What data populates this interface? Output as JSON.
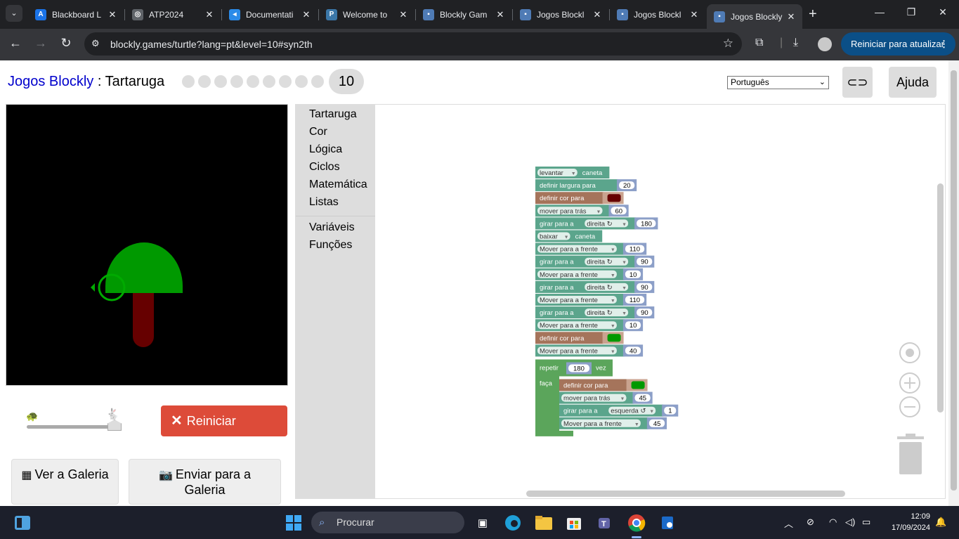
{
  "browser": {
    "tabs": [
      {
        "title": "Blackboard L",
        "favicon_color": "#1a73e8",
        "favicon_glyph": "A"
      },
      {
        "title": "ATP2024",
        "favicon_color": "#5f6368",
        "favicon_glyph": "◎"
      },
      {
        "title": "Documentati",
        "favicon_color": "#2b8be8",
        "favicon_glyph": "◂"
      },
      {
        "title": "Welcome to",
        "favicon_color": "#3b77a8",
        "favicon_glyph": "P"
      },
      {
        "title": "Blockly Gam",
        "favicon_color": "#4f7bb5",
        "favicon_glyph": "▪"
      },
      {
        "title": "Jogos Blockl",
        "favicon_color": "#4f7bb5",
        "favicon_glyph": "▪"
      },
      {
        "title": "Jogos Blockl",
        "favicon_color": "#4f7bb5",
        "favicon_glyph": "▪"
      },
      {
        "title": "Jogos Blockly",
        "favicon_color": "#4f7bb5",
        "favicon_glyph": "▪",
        "active": true
      }
    ],
    "url": "blockly.games/turtle?lang=pt&level=10#syn2th",
    "update_button": "Reiniciar para atualizar"
  },
  "header": {
    "home_link": "Jogos Blockly",
    "separator": " : ",
    "game_title": "Tartaruga",
    "current_level": "10",
    "language": "Português",
    "help_button": "Ajuda"
  },
  "controls": {
    "reset_button": "Reiniciar",
    "gallery_view": "Ver a Galeria",
    "gallery_submit": "Enviar para a Galeria"
  },
  "toolbox": {
    "categories": [
      "Tartaruga",
      "Cor",
      "Lógica",
      "Ciclos",
      "Matemática",
      "Listas"
    ],
    "categories_2": [
      "Variáveis",
      "Funções"
    ]
  },
  "program": {
    "blocks": [
      {
        "label": "levantar",
        "dropdown": true,
        "suffix": "caneta",
        "color": "#5ba58c"
      },
      {
        "label": "definir largura para",
        "value": "20",
        "color": "#5ba58c"
      },
      {
        "label": "definir cor para",
        "color_value": "#660000",
        "color": "#a5745b"
      },
      {
        "label": "mover para trás",
        "dropdown": true,
        "value": "60",
        "color": "#5ba58c"
      },
      {
        "label": "girar para a",
        "dir": "direita ↻",
        "value": "180",
        "color": "#5ba58c"
      },
      {
        "label": "baixar",
        "dropdown": true,
        "suffix": "caneta",
        "color": "#5ba58c"
      },
      {
        "label": "Mover para a frente",
        "dropdown": true,
        "value": "110",
        "color": "#5ba58c"
      },
      {
        "label": "girar para a",
        "dir": "direita ↻",
        "value": "90",
        "color": "#5ba58c"
      },
      {
        "label": "Mover para a frente",
        "dropdown": true,
        "value": "10",
        "color": "#5ba58c"
      },
      {
        "label": "girar para a",
        "dir": "direita ↻",
        "value": "90",
        "color": "#5ba58c"
      },
      {
        "label": "Mover para a frente",
        "dropdown": true,
        "value": "110",
        "color": "#5ba58c"
      },
      {
        "label": "girar para a",
        "dir": "direita ↻",
        "value": "90",
        "color": "#5ba58c"
      },
      {
        "label": "Mover para a frente",
        "dropdown": true,
        "value": "10",
        "color": "#5ba58c"
      },
      {
        "label": "definir cor para",
        "color_value": "#009900",
        "color": "#a5745b"
      },
      {
        "label": "Mover para a frente",
        "dropdown": true,
        "value": "40",
        "color": "#5ba58c"
      }
    ],
    "repeat": {
      "label": "repetir",
      "count": "180",
      "times": "vez",
      "do": "faça",
      "color": "#5ba55b",
      "body": [
        {
          "label": "definir cor para",
          "color_value": "#009900",
          "color": "#a5745b"
        },
        {
          "label": "mover para trás",
          "dropdown": true,
          "value": "45",
          "color": "#5ba58c"
        },
        {
          "label": "girar para a",
          "dir": "esquerda ↺",
          "value": "1",
          "color": "#5ba58c"
        },
        {
          "label": "Mover para a frente",
          "dropdown": true,
          "value": "45",
          "color": "#5ba58c"
        }
      ]
    }
  },
  "canvas": {
    "background": "#000000",
    "trunk_color": "#660000",
    "canopy_color": "#009900",
    "turtle_color": "#00aa00"
  },
  "taskbar": {
    "search_placeholder": "Procurar",
    "time": "12:09",
    "date": "17/09/2024"
  }
}
